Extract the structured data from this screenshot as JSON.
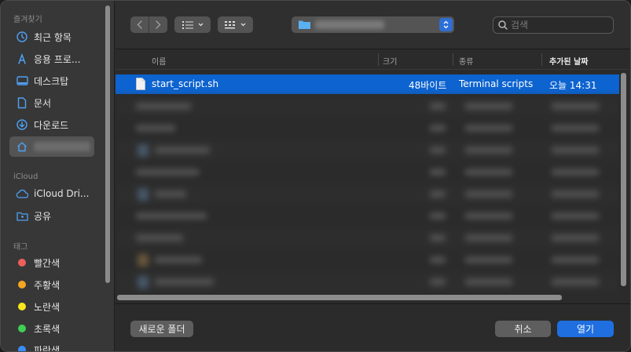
{
  "sidebar": {
    "favorites_title": "즐겨찾기",
    "favorites": [
      {
        "label": "최근 항목",
        "icon": "clock-icon"
      },
      {
        "label": "응용 프로...",
        "icon": "applications-icon"
      },
      {
        "label": "데스크탑",
        "icon": "desktop-icon"
      },
      {
        "label": "문서",
        "icon": "document-icon"
      },
      {
        "label": "다운로드",
        "icon": "download-icon"
      }
    ],
    "icloud_title": "iCloud",
    "icloud": [
      {
        "label": "iCloud Dri...",
        "icon": "cloud-icon"
      },
      {
        "label": "공유",
        "icon": "shared-folder-icon"
      }
    ],
    "tags_title": "태그",
    "tags": [
      {
        "label": "빨간색",
        "color": "#ee5f5b"
      },
      {
        "label": "주황색",
        "color": "#f5a623"
      },
      {
        "label": "노란색",
        "color": "#f8e71c"
      },
      {
        "label": "초록색",
        "color": "#3fcf55"
      },
      {
        "label": "파란색",
        "color": "#3a8ef6"
      }
    ]
  },
  "toolbar": {
    "search_placeholder": "검색",
    "accent": "#2d6fd6"
  },
  "columns": {
    "name": "이름",
    "size": "크기",
    "kind": "종류",
    "date_added": "추가된 날짜"
  },
  "files": [
    {
      "name": "start_script.sh",
      "size": "48바이트",
      "kind": "Terminal scripts",
      "date": "오늘 14:31",
      "selected": true
    }
  ],
  "buttons": {
    "new_folder": "새로운 폴더",
    "cancel": "취소",
    "open": "열기"
  }
}
